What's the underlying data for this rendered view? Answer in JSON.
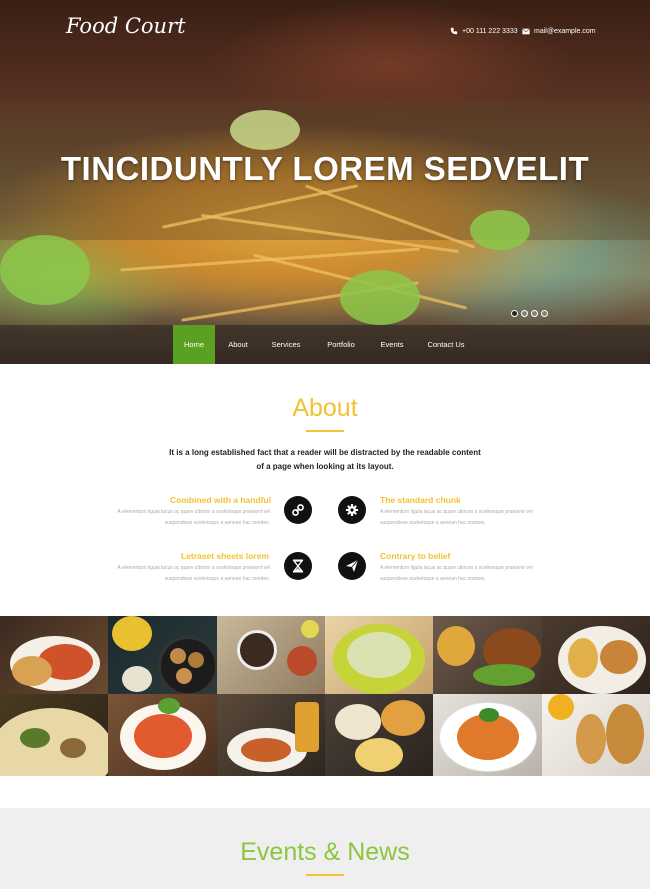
{
  "header": {
    "logo": "Food Court",
    "phone": "+00 111 222 3333",
    "email": "mail@example.com"
  },
  "hero": {
    "title": "TINCIDUNTLY LOREM SEDVELIT",
    "slides": 4,
    "active_slide": 1
  },
  "nav": {
    "items": [
      "Home",
      "About",
      "Services",
      "Portfolio",
      "Events",
      "Contact Us"
    ],
    "active": "Home"
  },
  "about": {
    "title": "About",
    "description_line1": "It is a long established fact that a reader will be distracted by the readable content",
    "description_line2": "of a page when looking at its layout.",
    "features": [
      {
        "title": "Combined with a handful",
        "icon": "link-icon",
        "line1": "A elementum ligula lacus ac quam ultrices a scelerisque praesent vel",
        "line2": "suspendisse scelerisque a aenean hac montes."
      },
      {
        "title": "The standard chunk",
        "icon": "gear-icon",
        "line1": "A elementum ligula lacus ac quam ultrices a scelerisque praesent vel",
        "line2": "suspendisse scelerisque a aenean hac montes."
      },
      {
        "title": "Letraset sheets lorem",
        "icon": "hourglass-icon",
        "line1": "A elementum ligula lacus ac quam ultrices a scelerisque praesent vel",
        "line2": "suspendisse scelerisque a aenean hac montes."
      },
      {
        "title": "Contrary to belief",
        "icon": "paper-plane-icon",
        "line1": "A elementum ligula lacus ac quam ultrices a scelerisque praesent vel",
        "line2": "suspendisse scelerisque a aenean hac montes."
      }
    ]
  },
  "events": {
    "title": "Events & News"
  },
  "colors": {
    "accent_yellow": "#f1c232",
    "accent_green": "#5aa021",
    "events_green": "#8cc63f"
  }
}
